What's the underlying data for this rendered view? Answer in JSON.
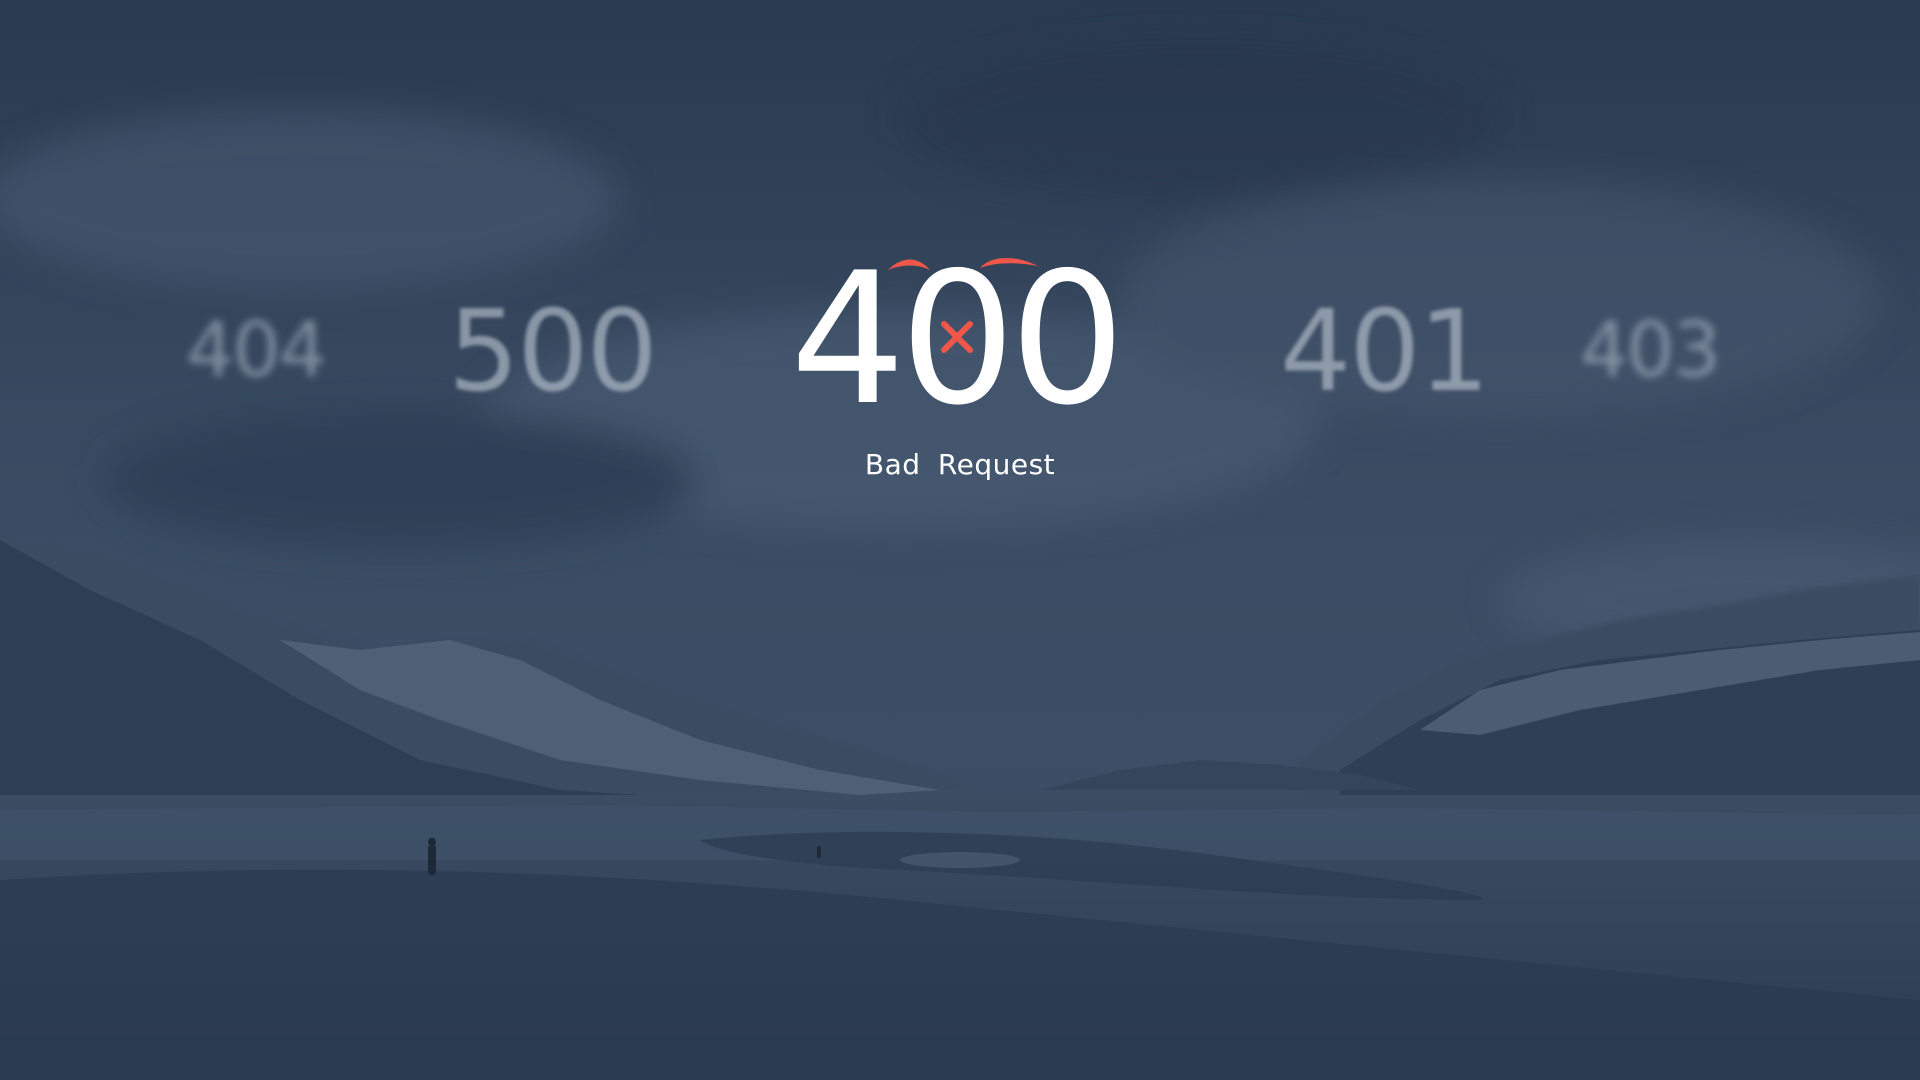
{
  "error": {
    "code": "400",
    "message": "Bad Request"
  },
  "background_codes": [
    {
      "code": "404"
    },
    {
      "code": "500"
    },
    {
      "code": "401"
    },
    {
      "code": "403"
    }
  ],
  "colors": {
    "background": "#2b3b50",
    "accent": "#f0564a",
    "text": "#ffffff"
  },
  "icons": [
    "angry-eyebrow-icon",
    "close-x-icon"
  ]
}
